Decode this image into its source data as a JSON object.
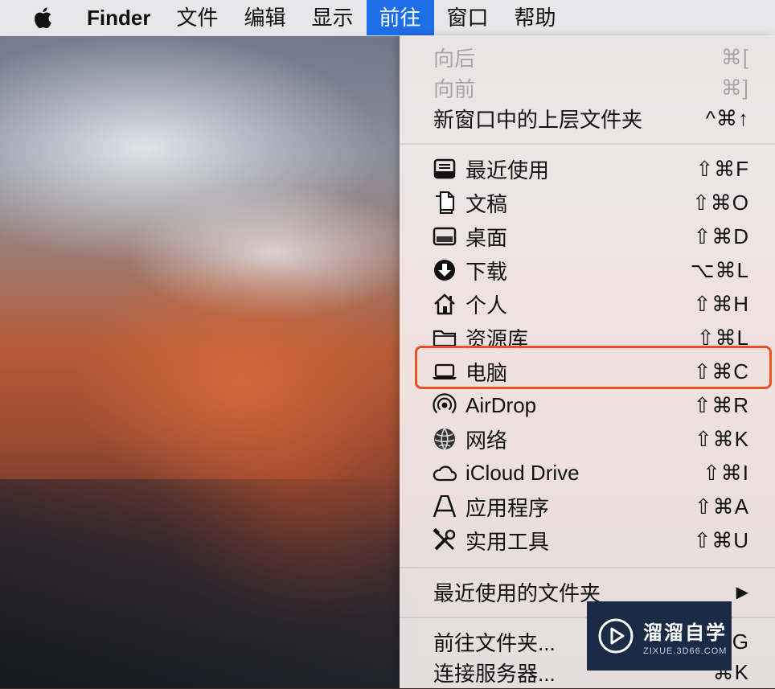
{
  "menubar": {
    "apple_icon": "apple-icon",
    "app_name": "Finder",
    "menus": [
      "文件",
      "编辑",
      "显示",
      "前往",
      "窗口",
      "帮助"
    ],
    "active_menu": "前往",
    "active_color": "#1e6ee8"
  },
  "go_menu": {
    "group1": [
      {
        "label": "向后",
        "shortcut": "⌘[",
        "disabled": true
      },
      {
        "label": "向前",
        "shortcut": "⌘]",
        "disabled": true
      },
      {
        "label": "新窗口中的上层文件夹",
        "shortcut": "^⌘↑",
        "disabled": false
      }
    ],
    "group2": [
      {
        "label": "最近使用",
        "shortcut": "⇧⌘F",
        "icon": "recents-icon"
      },
      {
        "label": "文稿",
        "shortcut": "⇧⌘O",
        "icon": "documents-icon"
      },
      {
        "label": "桌面",
        "shortcut": "⇧⌘D",
        "icon": "desktop-icon"
      },
      {
        "label": "下载",
        "shortcut": "⌥⌘L",
        "icon": "download-icon"
      },
      {
        "label": "个人",
        "shortcut": "⇧⌘H",
        "icon": "home-icon"
      },
      {
        "label": "资源库",
        "shortcut": "⇧⌘L",
        "icon": "folder-icon"
      },
      {
        "label": "电脑",
        "shortcut": "⇧⌘C",
        "icon": "laptop-icon",
        "highlighted": true
      },
      {
        "label": "AirDrop",
        "shortcut": "⇧⌘R",
        "icon": "airdrop-icon"
      },
      {
        "label": "网络",
        "shortcut": "⇧⌘K",
        "icon": "network-icon"
      },
      {
        "label": "iCloud Drive",
        "shortcut": "⇧⌘I",
        "icon": "cloud-icon"
      },
      {
        "label": "应用程序",
        "shortcut": "⇧⌘A",
        "icon": "applications-icon"
      },
      {
        "label": "实用工具",
        "shortcut": "⇧⌘U",
        "icon": "utilities-icon"
      }
    ],
    "group3": [
      {
        "label": "最近使用的文件夹",
        "shortcut": "▶"
      }
    ],
    "group4": [
      {
        "label": "前往文件夹...",
        "shortcut": "G"
      },
      {
        "label": "连接服务器...",
        "shortcut": "⌘K"
      }
    ],
    "highlight_color": "#f05024"
  },
  "watermark": {
    "title": "溜溜自学",
    "subtitle": "ZIXUE.3D66.COM"
  }
}
